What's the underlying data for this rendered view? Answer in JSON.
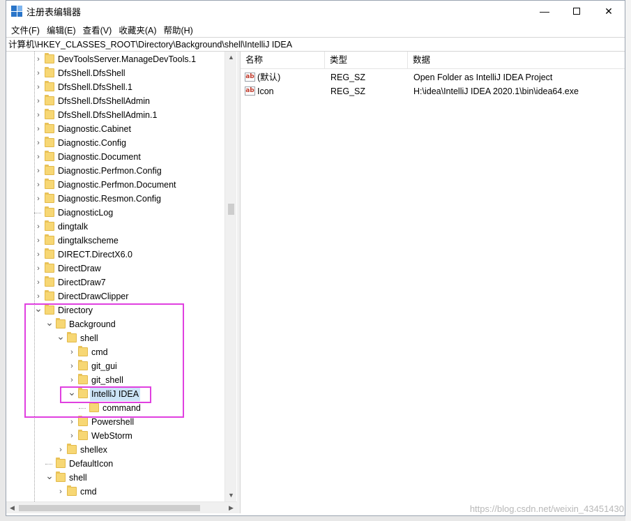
{
  "window": {
    "title": "注册表编辑器",
    "controls": {
      "minimize": "—",
      "close": "✕"
    }
  },
  "menu": [
    "文件(F)",
    "编辑(E)",
    "查看(V)",
    "收藏夹(A)",
    "帮助(H)"
  ],
  "address": "计算机\\HKEY_CLASSES_ROOT\\Directory\\Background\\shell\\IntelliJ IDEA",
  "tree": [
    {
      "label": "DevToolsServer.ManageDevTools.1",
      "depth": 0,
      "expand": "collapsed"
    },
    {
      "label": "DfsShell.DfsShell",
      "depth": 0,
      "expand": "collapsed"
    },
    {
      "label": "DfsShell.DfsShell.1",
      "depth": 0,
      "expand": "collapsed"
    },
    {
      "label": "DfsShell.DfsShellAdmin",
      "depth": 0,
      "expand": "collapsed"
    },
    {
      "label": "DfsShell.DfsShellAdmin.1",
      "depth": 0,
      "expand": "collapsed"
    },
    {
      "label": "Diagnostic.Cabinet",
      "depth": 0,
      "expand": "collapsed"
    },
    {
      "label": "Diagnostic.Config",
      "depth": 0,
      "expand": "collapsed"
    },
    {
      "label": "Diagnostic.Document",
      "depth": 0,
      "expand": "collapsed"
    },
    {
      "label": "Diagnostic.Perfmon.Config",
      "depth": 0,
      "expand": "collapsed"
    },
    {
      "label": "Diagnostic.Perfmon.Document",
      "depth": 0,
      "expand": "collapsed"
    },
    {
      "label": "Diagnostic.Resmon.Config",
      "depth": 0,
      "expand": "collapsed"
    },
    {
      "label": "DiagnosticLog",
      "depth": 0,
      "expand": "none"
    },
    {
      "label": "dingtalk",
      "depth": 0,
      "expand": "collapsed"
    },
    {
      "label": "dingtalkscheme",
      "depth": 0,
      "expand": "collapsed"
    },
    {
      "label": "DIRECT.DirectX6.0",
      "depth": 0,
      "expand": "collapsed"
    },
    {
      "label": "DirectDraw",
      "depth": 0,
      "expand": "collapsed"
    },
    {
      "label": "DirectDraw7",
      "depth": 0,
      "expand": "collapsed"
    },
    {
      "label": "DirectDrawClipper",
      "depth": 0,
      "expand": "collapsed"
    },
    {
      "label": "Directory",
      "depth": 0,
      "expand": "expanded"
    },
    {
      "label": "Background",
      "depth": 1,
      "expand": "expanded"
    },
    {
      "label": "shell",
      "depth": 2,
      "expand": "expanded"
    },
    {
      "label": "cmd",
      "depth": 3,
      "expand": "collapsed"
    },
    {
      "label": "git_gui",
      "depth": 3,
      "expand": "collapsed"
    },
    {
      "label": "git_shell",
      "depth": 3,
      "expand": "collapsed"
    },
    {
      "label": "IntelliJ IDEA",
      "depth": 3,
      "expand": "expanded",
      "selected": true
    },
    {
      "label": "command",
      "depth": 4,
      "expand": "none"
    },
    {
      "label": "Powershell",
      "depth": 3,
      "expand": "collapsed"
    },
    {
      "label": "WebStorm",
      "depth": 3,
      "expand": "collapsed"
    },
    {
      "label": "shellex",
      "depth": 2,
      "expand": "collapsed"
    },
    {
      "label": "DefaultIcon",
      "depth": 1,
      "expand": "none"
    },
    {
      "label": "shell",
      "depth": 1,
      "expand": "expanded"
    },
    {
      "label": "cmd",
      "depth": 2,
      "expand": "collapsed"
    }
  ],
  "list": {
    "columns": [
      "名称",
      "类型",
      "数据"
    ],
    "rows": [
      {
        "name": "(默认)",
        "type": "REG_SZ",
        "data": "Open Folder as IntelliJ IDEA Project"
      },
      {
        "name": "Icon",
        "type": "REG_SZ",
        "data": "H:\\idea\\IntelliJ IDEA 2020.1\\bin\\idea64.exe"
      }
    ]
  },
  "icons": {
    "value_icon_text": "ab"
  },
  "watermark": "https://blog.csdn.net/weixin_43451430",
  "colors": {
    "highlight": "#e040e0",
    "selection": "#cce4f7",
    "folder": "#f7d774"
  }
}
